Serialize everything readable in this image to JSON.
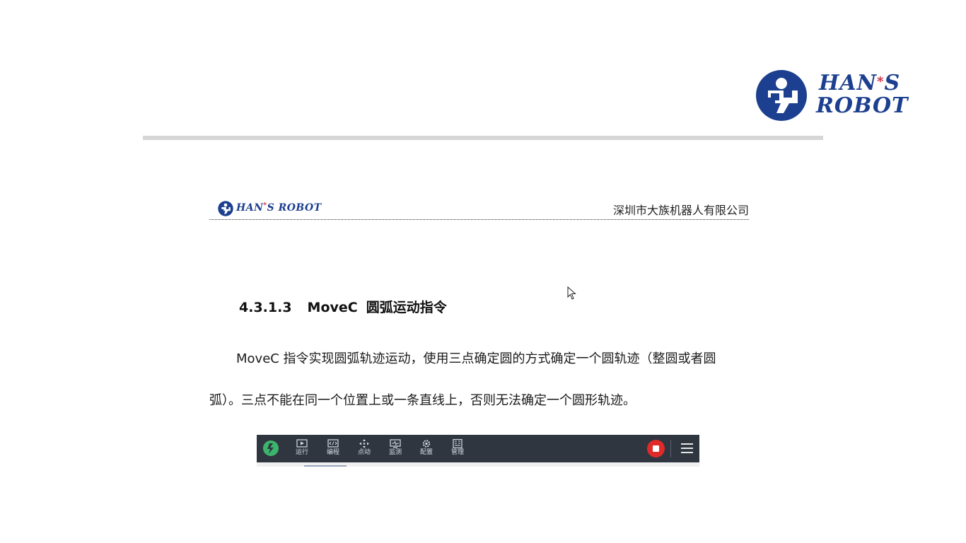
{
  "brand": {
    "line1_pre": "HAN",
    "star": "*",
    "line1_post": "S",
    "line2": "ROBOT",
    "mini_pre": "HAN",
    "mini_post": "S ROBOT",
    "color": "#1c3f8f",
    "star_color": "#d0203a"
  },
  "doc_header": {
    "company": "深圳市大族机器人有限公司"
  },
  "section": {
    "number": "4.3.1.3",
    "command": "MoveC",
    "title": "圆弧运动指令"
  },
  "paragraph": {
    "line1": "MoveC 指令实现圆弧轨迹运动，使用三点确定圆的方式确定一个圆轨迹（整圆或者圆",
    "line2": "弧）。三点不能在同一个位置上或一条直线上，否则无法确定一个圆形轨迹。"
  },
  "toolbar": {
    "items": [
      {
        "label": "运行",
        "icon": "play-icon"
      },
      {
        "label": "编程",
        "icon": "code-icon"
      },
      {
        "label": "点动",
        "icon": "move-icon"
      },
      {
        "label": "监测",
        "icon": "monitor-icon"
      },
      {
        "label": "配置",
        "icon": "gear-icon"
      },
      {
        "label": "管理",
        "icon": "manage-icon"
      }
    ],
    "stop_color": "#e02a2a",
    "bg_color": "#2f3640"
  }
}
